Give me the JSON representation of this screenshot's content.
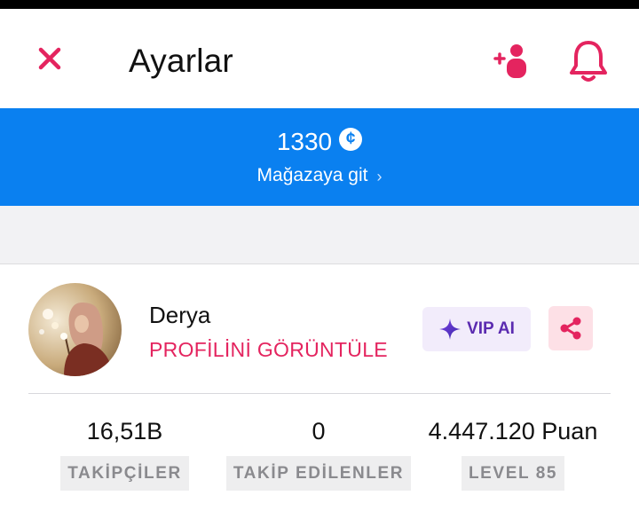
{
  "header": {
    "title": "Ayarlar",
    "close_icon": "close-icon",
    "add_friend_icon": "add-friend-icon",
    "notification_icon": "bell-icon"
  },
  "coins": {
    "amount": "1330",
    "currency_symbol": "¢",
    "store_link": "Mağazaya git",
    "chevron": "›"
  },
  "profile": {
    "name": "Derya",
    "view_profile": "PROFİLİNİ GÖRÜNTÜLE",
    "vip_label": "VIP AI",
    "share_icon": "share-icon"
  },
  "stats": [
    {
      "value": "16,51B",
      "label": "TAKİPÇİLER"
    },
    {
      "value": "0",
      "label": "TAKİP EDİLENLER"
    },
    {
      "value": "4.447.120 Puan",
      "label": "LEVEL 85"
    }
  ],
  "colors": {
    "accent_pink": "#e4245f",
    "banner_blue": "#0a80f0",
    "vip_purple": "#5b2bb0"
  }
}
